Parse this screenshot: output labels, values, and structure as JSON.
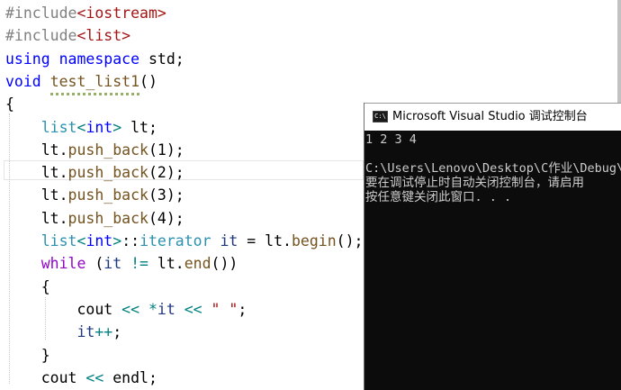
{
  "editor": {
    "lines": [
      {
        "parts": [
          [
            "pp",
            "#include"
          ],
          [
            "inc",
            "<iostream>"
          ]
        ]
      },
      {
        "parts": [
          [
            "pp",
            "#include"
          ],
          [
            "inc",
            "<list>"
          ]
        ]
      },
      {
        "parts": [
          [
            "kw",
            "using"
          ],
          [
            "",
            " "
          ],
          [
            "kw",
            "namespace"
          ],
          [
            "",
            " std;"
          ]
        ]
      },
      {
        "parts": [
          [
            "kw",
            "void"
          ],
          [
            "",
            " "
          ],
          [
            "fn",
            "test_list1"
          ],
          [
            "",
            "()"
          ]
        ]
      },
      {
        "parts": [
          [
            "",
            "{"
          ]
        ]
      },
      {
        "parts": [
          [
            "",
            "    "
          ],
          [
            "ty",
            "list"
          ],
          [
            "op",
            "<"
          ],
          [
            "kw",
            "int"
          ],
          [
            "op",
            ">"
          ],
          [
            "",
            " lt;"
          ]
        ]
      },
      {
        "parts": [
          [
            "",
            "    lt."
          ],
          [
            "fn",
            "push_back"
          ],
          [
            "",
            "(1);"
          ]
        ]
      },
      {
        "parts": [
          [
            "",
            "    lt."
          ],
          [
            "fn",
            "push_back"
          ],
          [
            "",
            "(2);"
          ]
        ]
      },
      {
        "parts": [
          [
            "",
            "    lt."
          ],
          [
            "fn",
            "push_back"
          ],
          [
            "",
            "(3);"
          ]
        ]
      },
      {
        "parts": [
          [
            "",
            "    lt."
          ],
          [
            "fn",
            "push_back"
          ],
          [
            "",
            "(4);"
          ]
        ]
      },
      {
        "parts": [
          [
            "",
            "    "
          ],
          [
            "ty",
            "list"
          ],
          [
            "op",
            "<"
          ],
          [
            "kw",
            "int"
          ],
          [
            "op",
            ">"
          ],
          [
            "",
            "::"
          ],
          [
            "ty",
            "iterator"
          ],
          [
            "",
            " "
          ],
          [
            "var",
            "it"
          ],
          [
            "",
            " = lt."
          ],
          [
            "fn",
            "begin"
          ],
          [
            "",
            "();"
          ]
        ]
      },
      {
        "parts": [
          [
            "",
            "    "
          ],
          [
            "ctrl",
            "while"
          ],
          [
            "",
            " ("
          ],
          [
            "var",
            "it"
          ],
          [
            "",
            " "
          ],
          [
            "op",
            "!="
          ],
          [
            "",
            " lt."
          ],
          [
            "fn",
            "end"
          ],
          [
            "",
            "())"
          ]
        ]
      },
      {
        "parts": [
          [
            "",
            "    {"
          ]
        ]
      },
      {
        "parts": [
          [
            "",
            "        cout "
          ],
          [
            "op",
            "<<"
          ],
          [
            "",
            " "
          ],
          [
            "op",
            "*"
          ],
          [
            "var",
            "it"
          ],
          [
            "",
            " "
          ],
          [
            "op",
            "<<"
          ],
          [
            "",
            " "
          ],
          [
            "str",
            "\" \""
          ],
          [
            "",
            ";"
          ]
        ]
      },
      {
        "parts": [
          [
            "",
            "        "
          ],
          [
            "var",
            "it"
          ],
          [
            "op",
            "++"
          ],
          [
            "",
            ";"
          ]
        ]
      },
      {
        "parts": [
          [
            "",
            "    }"
          ]
        ]
      },
      {
        "parts": [
          [
            "",
            "    cout "
          ],
          [
            "op",
            "<<"
          ],
          [
            "",
            " endl;"
          ]
        ]
      }
    ]
  },
  "console": {
    "title": "Microsoft Visual Studio 调试控制台",
    "icon_label": "C:\\",
    "output_lines": [
      "1 2 3 4",
      "",
      "C:\\Users\\Lenovo\\Desktop\\C作业\\Debug\\",
      "要在调试停止时自动关闭控制台，请启用",
      "按任意键关闭此窗口. . ."
    ]
  }
}
